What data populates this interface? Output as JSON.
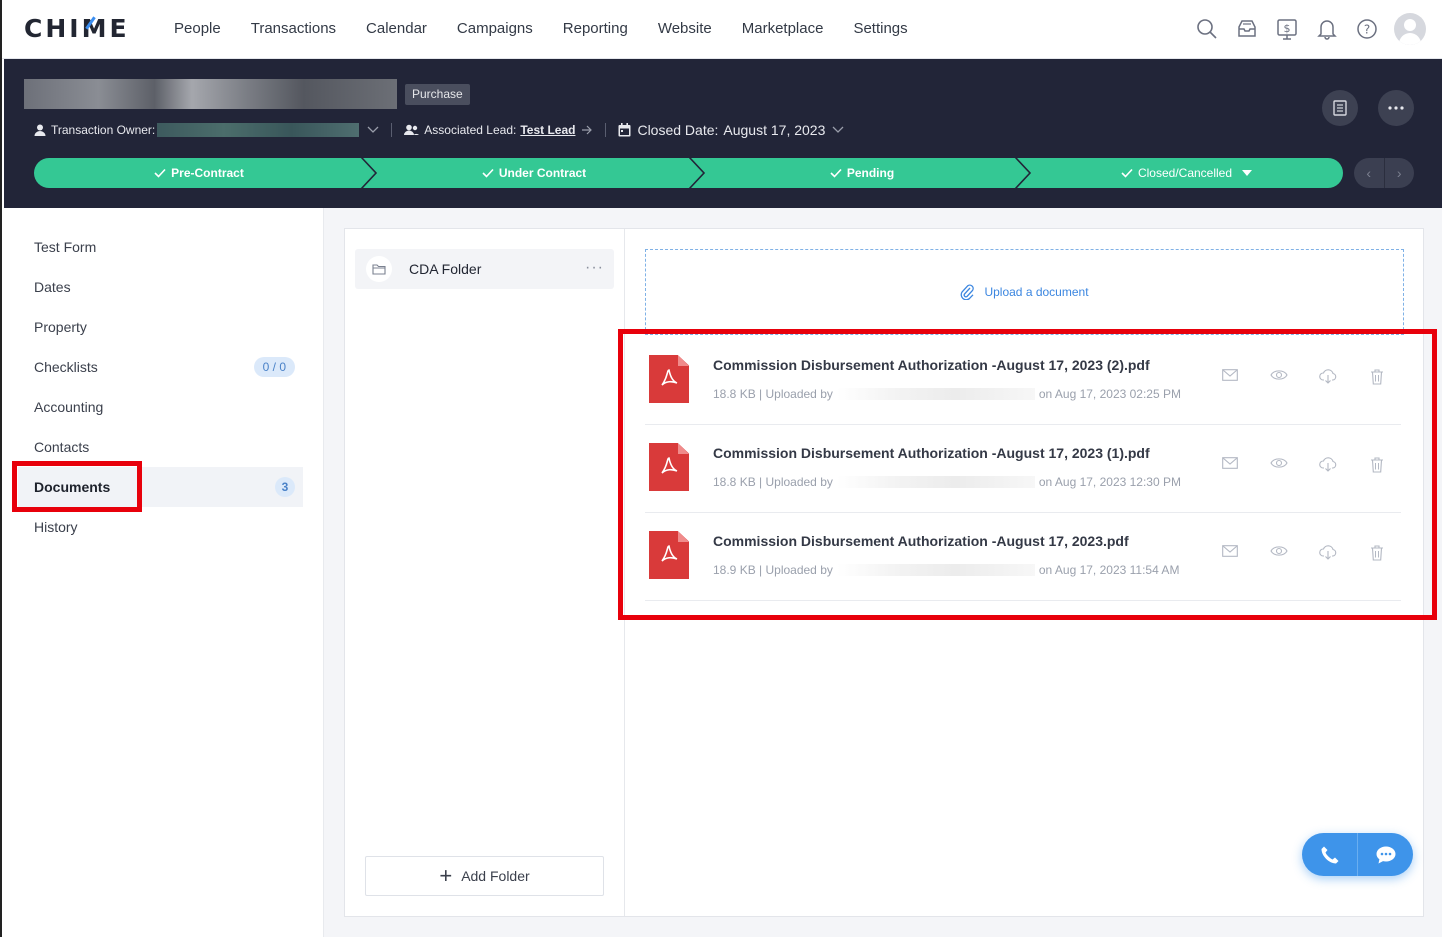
{
  "app": {
    "logo": "CHIME",
    "nav": [
      "People",
      "Transactions",
      "Calendar",
      "Campaigns",
      "Reporting",
      "Website",
      "Marketplace",
      "Settings"
    ],
    "nav_icons": [
      "search-icon",
      "inbox-icon",
      "billing-icon",
      "bell-icon",
      "help-icon"
    ]
  },
  "header": {
    "tag": "Purchase",
    "owner_label": "Transaction Owner:",
    "lead_label": "Associated Lead:",
    "lead_name": "Test Lead",
    "closed_label": "Closed Date:",
    "closed_date": "August 17, 2023",
    "stages": [
      "Pre-Contract",
      "Under Contract",
      "Pending",
      "Closed/Cancelled"
    ],
    "stage_color": "#34c894"
  },
  "sidebar": {
    "items": [
      {
        "label": "Test Form"
      },
      {
        "label": "Dates"
      },
      {
        "label": "Property"
      },
      {
        "label": "Checklists",
        "badge": "0 / 0"
      },
      {
        "label": "Accounting"
      },
      {
        "label": "Contacts"
      },
      {
        "label": "Documents",
        "badge": "3",
        "active": true
      },
      {
        "label": "History"
      }
    ]
  },
  "folders": {
    "items": [
      {
        "name": "CDA Folder"
      }
    ],
    "add_label": "Add Folder"
  },
  "upload": {
    "label": "Upload a document"
  },
  "documents": [
    {
      "name": "Commission Disbursement Authorization -August 17, 2023 (2).pdf",
      "size": "18.8 KB | Uploaded by",
      "when": "on Aug 17, 2023 02:25 PM"
    },
    {
      "name": "Commission Disbursement Authorization -August 17, 2023 (1).pdf",
      "size": "18.8 KB | Uploaded by",
      "when": "on Aug 17, 2023 12:30 PM"
    },
    {
      "name": "Commission Disbursement Authorization -August 17, 2023.pdf",
      "size": "18.9 KB | Uploaded by",
      "when": "on Aug 17, 2023 11:54 AM"
    }
  ],
  "colors": {
    "accent": "#3e94ea",
    "highlight": "#e8000b",
    "pdf": "#d93a3a"
  }
}
